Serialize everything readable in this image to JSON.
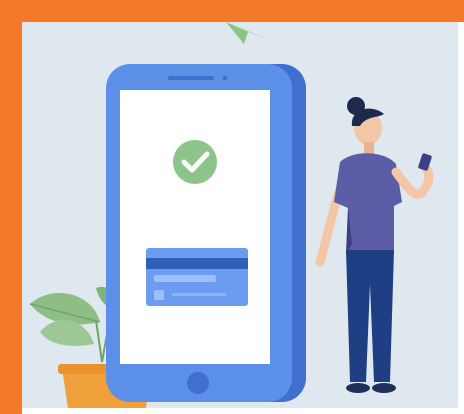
{
  "colors": {
    "frame_orange": "#f47a2a",
    "scene_background": "#dfe8ef",
    "phone_body": "#5b8fe8",
    "phone_shadow": "#3f6fcf",
    "phone_screen": "#ffffff",
    "check_circle": "#8cc48a",
    "card_body": "#6b9cf0",
    "card_stripe": "#2f5fb8",
    "woman_top": "#5b5ea6",
    "woman_pants": "#1f3f84",
    "skin": "#f3c6a6",
    "hair": "#1d2a4e",
    "leaf_green": "#8ebe86",
    "pot": "#f0a03a",
    "paper_plane": "#a8d6a0"
  },
  "icons": {
    "success": "check-icon",
    "payment": "credit-card-icon",
    "home_button": "home-button-icon"
  }
}
